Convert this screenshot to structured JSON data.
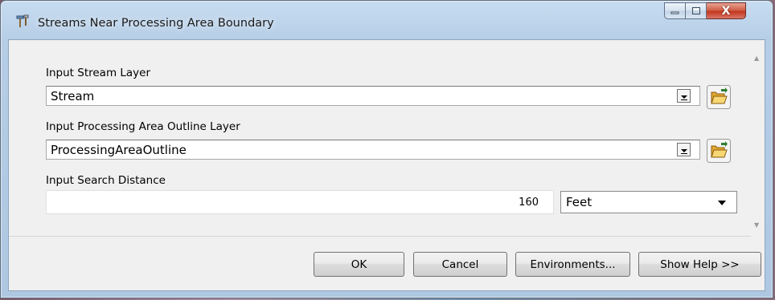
{
  "window": {
    "title": "Streams Near Processing Area Boundary",
    "icons": {
      "app": "toolbox-hammer-icon",
      "minimize": "minimize-icon",
      "maximize": "maximize-icon",
      "close": "close-icon"
    },
    "close_glyph": "X"
  },
  "params": [
    {
      "label": "Input Stream Layer",
      "value": "Stream",
      "browse_icon": "open-folder-icon"
    },
    {
      "label": "Input Processing Area Outline Layer",
      "value": "ProcessingAreaOutline",
      "browse_icon": "open-folder-icon"
    }
  ],
  "search_distance": {
    "label": "Input Search Distance",
    "value": "160",
    "unit": "Feet"
  },
  "buttons": {
    "ok": "OK",
    "cancel": "Cancel",
    "environments": "Environments...",
    "show_help": "Show Help >>"
  },
  "colors": {
    "close_button": "#c3361d",
    "folder_icon": "#f2c94c"
  }
}
